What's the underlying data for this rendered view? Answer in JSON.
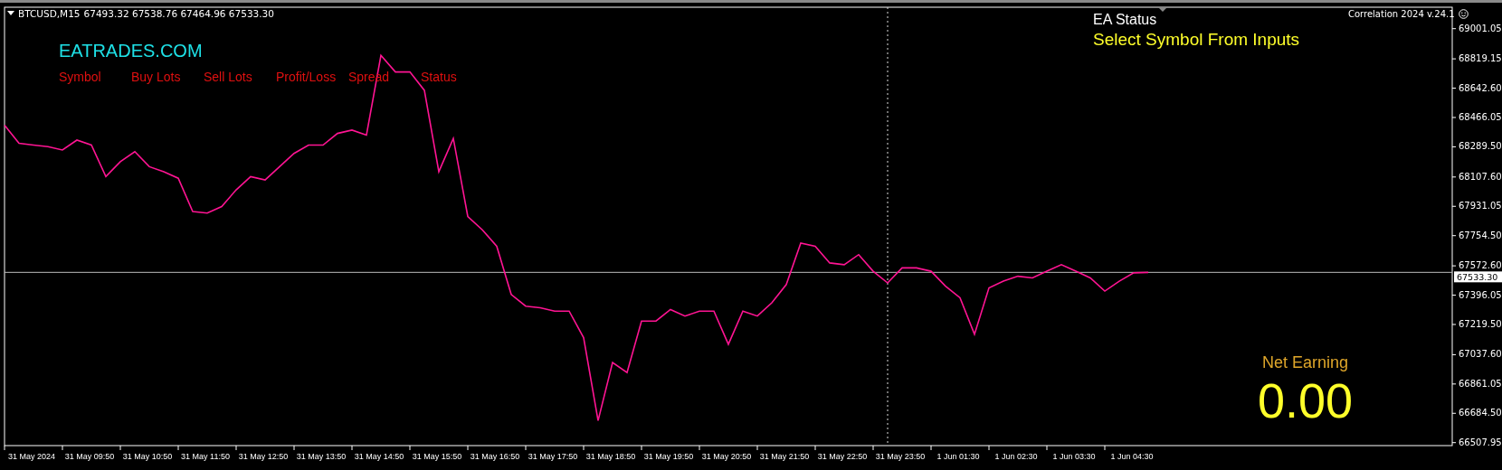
{
  "symbol_bar": {
    "symbol": "BTCUSD,M15",
    "ohlc": "67493.32 67538.76 67464.96 67533.30"
  },
  "indicator_panel": {
    "site": "EATRADES.COM",
    "columns": [
      "Symbol",
      "Buy Lots",
      "Sell Lots",
      "Profit/Loss",
      "Spread",
      "Status"
    ]
  },
  "ea_status": {
    "title": "EA Status",
    "message": "Select Symbol From Inputs"
  },
  "expert_label": "Correlation 2024 v.24.1",
  "net_earning": {
    "label": "Net Earning",
    "value": "0.00"
  },
  "chart": {
    "chart_data": {
      "type": "line",
      "ylim": [
        66490,
        69130
      ],
      "categories": [
        null,
        null,
        "31 May 2024",
        null,
        null,
        null,
        "31 May 09:50",
        null,
        null,
        null,
        "31 May 10:50",
        null,
        null,
        null,
        "31 May 11:50",
        null,
        null,
        null,
        "31 May 12:50",
        null,
        null,
        null,
        "31 May 13:50",
        null,
        null,
        null,
        "31 May 14:50",
        null,
        null,
        null,
        "31 May 15:50",
        null,
        null,
        null,
        "31 May 16:50",
        null,
        null,
        null,
        "31 May 17:50",
        null,
        null,
        null,
        "31 May 18:50",
        null,
        null,
        null,
        "31 May 19:50",
        null,
        null,
        null,
        "31 May 20:50",
        null,
        null,
        null,
        "31 May 21:50",
        null,
        null,
        null,
        "31 May 22:50",
        null,
        null,
        null,
        "31 May 23:50",
        null,
        null,
        null,
        "1 Jun 01:30",
        null,
        null,
        null,
        "1 Jun 02:30",
        null,
        null,
        null,
        "1 Jun 03:30",
        null,
        null,
        null,
        "1 Jun 04:30",
        null
      ],
      "series": [
        {
          "color": "#ff1493",
          "values": [
            68420,
            68310,
            68300,
            68290,
            68270,
            68330,
            68300,
            68110,
            68200,
            68260,
            68170,
            68140,
            68100,
            67900,
            67890,
            67930,
            68030,
            68110,
            68090,
            68170,
            68250,
            68300,
            68300,
            68370,
            68390,
            68360,
            68840,
            68740,
            68740,
            68630,
            68140,
            68340,
            67870,
            67790,
            67690,
            67400,
            67330,
            67320,
            67300,
            67300,
            67140,
            66640,
            66990,
            66930,
            67240,
            67240,
            67310,
            67270,
            67300,
            67300,
            67100,
            67300,
            67270,
            67350,
            67460,
            67710,
            67690,
            67590,
            67580,
            67640,
            67540,
            67470,
            67560,
            67560,
            67540,
            67450,
            67380,
            67160,
            67440,
            67480,
            67510,
            67500,
            67540,
            67580,
            67540,
            67500,
            67420,
            67480,
            67530,
            67533
          ]
        }
      ],
      "yticks": [
        {
          "value": 69001.05,
          "label": "69001.05"
        },
        {
          "value": 68819.15,
          "label": "68819.15"
        },
        {
          "value": 68642.6,
          "label": "68642.60"
        },
        {
          "value": 68466.05,
          "label": "68466.05"
        },
        {
          "value": 68289.5,
          "label": "68289.50"
        },
        {
          "value": 68107.6,
          "label": "68107.60"
        },
        {
          "value": 67931.05,
          "label": "67931.05"
        },
        {
          "value": 67754.5,
          "label": "67754.50"
        },
        {
          "value": 67572.6,
          "label": "67572.60"
        },
        {
          "value": 67396.05,
          "label": "67396.05"
        },
        {
          "value": 67219.5,
          "label": "67219.50"
        },
        {
          "value": 67037.6,
          "label": "67037.60"
        },
        {
          "value": 66861.05,
          "label": "66861.05"
        },
        {
          "value": 66684.5,
          "label": "66684.50"
        },
        {
          "value": 66507.95,
          "label": "66507.95"
        }
      ],
      "ref_lines": [
        {
          "axis": "y",
          "value": 67533.3,
          "label": "67533.30"
        }
      ]
    }
  }
}
